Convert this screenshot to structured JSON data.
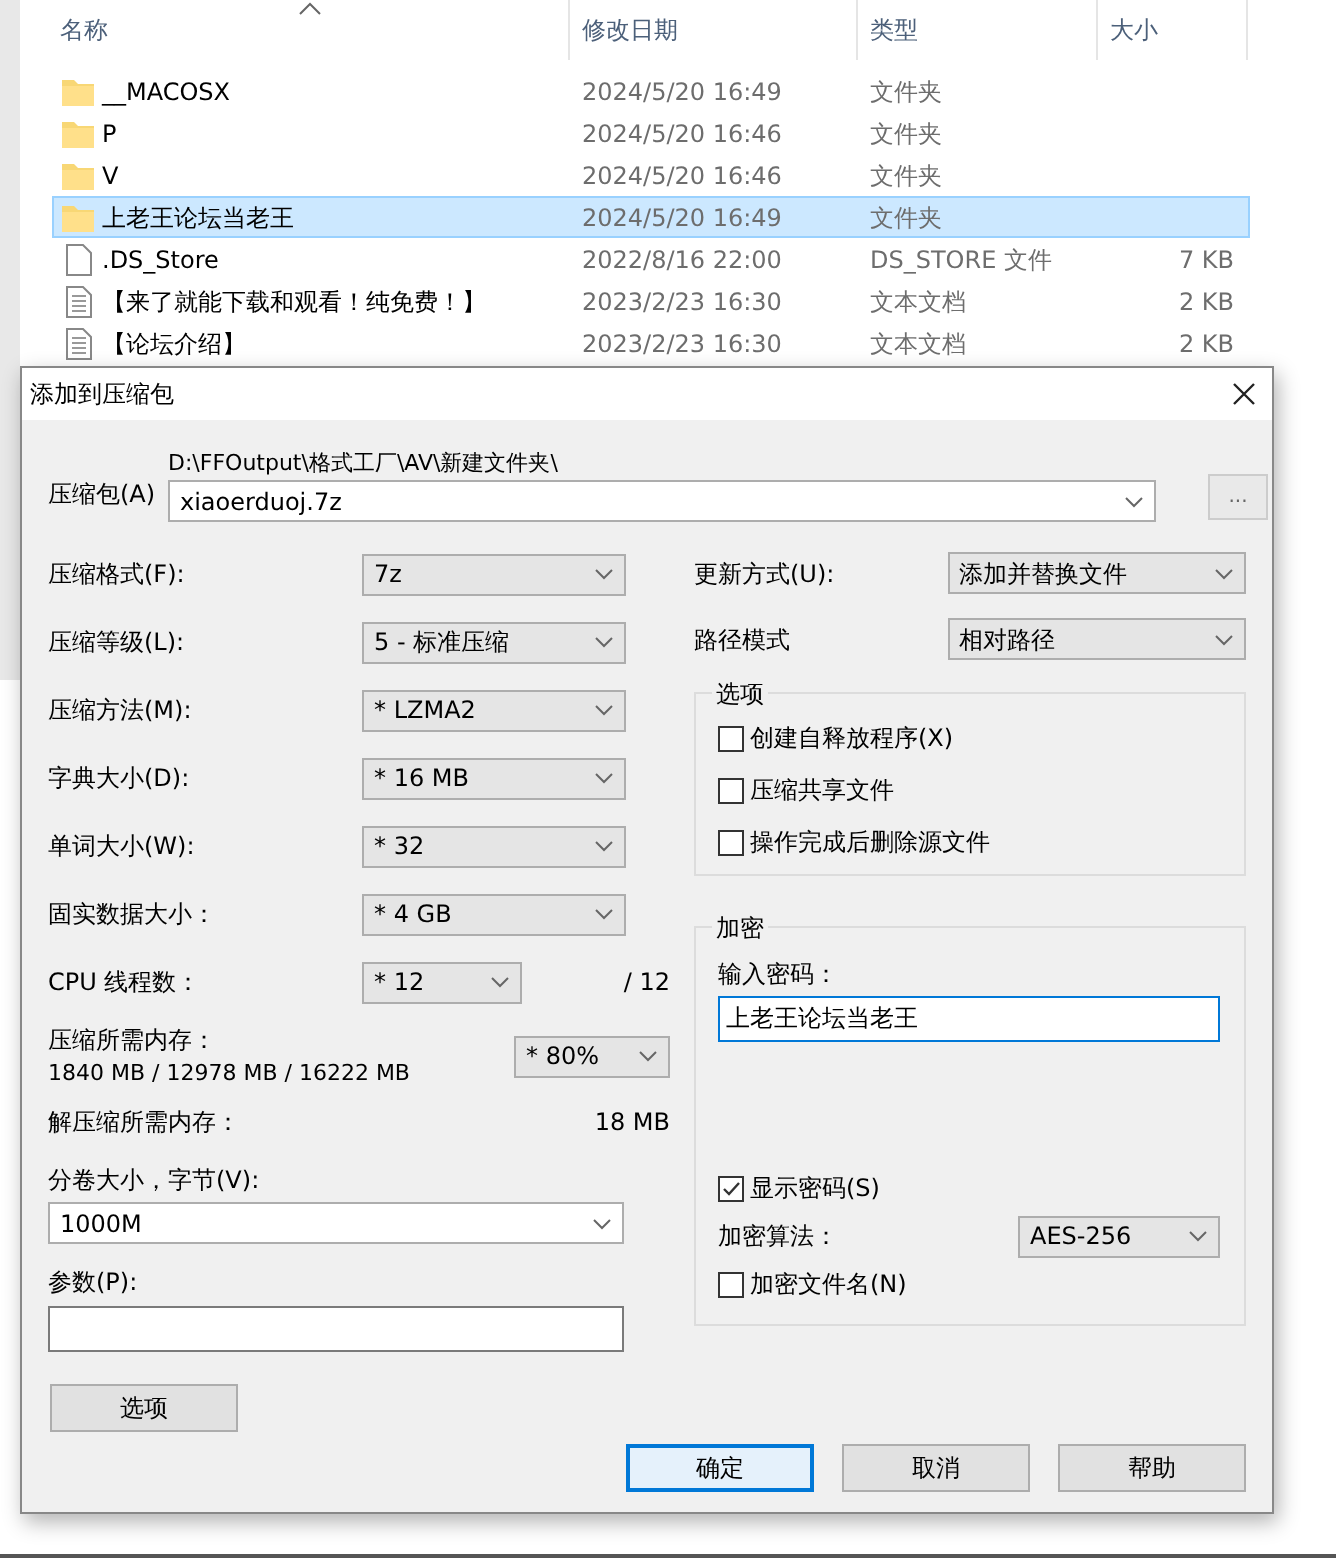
{
  "explorer": {
    "columns": [
      "名称",
      "修改日期",
      "类型",
      "大小"
    ],
    "rows": [
      {
        "name": "__MACOSX",
        "date": "2024/5/20 16:49",
        "type": "文件夹",
        "kind": "folder",
        "selected": false
      },
      {
        "name": "P",
        "date": "2024/5/20 16:46",
        "type": "文件夹",
        "kind": "folder",
        "selected": false
      },
      {
        "name": "V",
        "date": "2024/5/20 16:46",
        "type": "文件夹",
        "kind": "folder",
        "selected": false
      },
      {
        "name": "上老王论坛当老王",
        "date": "2024/5/20 16:49",
        "type": "文件夹",
        "kind": "folder",
        "selected": true
      },
      {
        "name": ".DS_Store",
        "date": "2022/8/16 22:00",
        "type": "DS_STORE 文件",
        "size": "7 KB",
        "kind": "file",
        "selected": false
      },
      {
        "name": "【来了就能下载和观看！纯免费！】",
        "date": "2023/2/23 16:30",
        "type": "文本文档",
        "size": "2 KB",
        "kind": "text",
        "selected": false
      },
      {
        "name": "【论坛介绍】",
        "date": "2023/2/23 16:30",
        "type": "文本文档",
        "size": "2 KB",
        "kind": "text",
        "selected": false
      }
    ]
  },
  "dialog": {
    "title": "添加到压缩包",
    "archive": {
      "label": "压缩包(A)",
      "path": "D:\\FFOutput\\格式工厂\\AV\\新建文件夹\\",
      "value": "xiaoerduoj.7z",
      "browse": "..."
    },
    "left_rows": [
      {
        "label": "压缩格式(F):",
        "value": "7z"
      },
      {
        "label": "压缩等级(L):",
        "value": "5 - 标准压缩"
      },
      {
        "label": "压缩方法(M):",
        "value": "*  LZMA2"
      },
      {
        "label": "字典大小(D):",
        "value": "*  16 MB"
      },
      {
        "label": "单词大小(W):",
        "value": "*  32"
      },
      {
        "label": "固实数据大小：",
        "value": "*  4 GB"
      }
    ],
    "cpu": {
      "label": "CPU 线程数：",
      "value": "*  12",
      "max": "/ 12"
    },
    "memory": {
      "label": "压缩所需内存：",
      "numbers": "1840 MB / 12978 MB / 16222 MB",
      "value": "* 80%"
    },
    "decompress": {
      "label": "解压缩所需内存：",
      "value": "18 MB"
    },
    "split": {
      "label": "分卷大小，字节(V):",
      "value": "1000M"
    },
    "params": {
      "label": "参数(P):"
    },
    "options_button": "选项",
    "update": {
      "label": "更新方式(U):",
      "value": "添加并替换文件"
    },
    "path_mode": {
      "label": "路径模式",
      "value": "相对路径"
    },
    "options_group": {
      "title": "选项",
      "items": [
        {
          "label": "创建自释放程序(X)",
          "checked": false
        },
        {
          "label": "压缩共享文件",
          "checked": false
        },
        {
          "label": "操作完成后删除源文件",
          "checked": false
        }
      ]
    },
    "encryption": {
      "title": "加密",
      "password_label": "输入密码：",
      "password": "上老王论坛当老王",
      "show_password": {
        "label": "显示密码(S)",
        "checked": true
      },
      "method_label": "加密算法：",
      "method": "AES-256",
      "encrypt_names": {
        "label": "加密文件名(N)",
        "checked": false
      }
    },
    "buttons": [
      {
        "label": "确定",
        "default": true
      },
      {
        "label": "取消",
        "default": false
      },
      {
        "label": "帮助",
        "default": false
      }
    ]
  }
}
